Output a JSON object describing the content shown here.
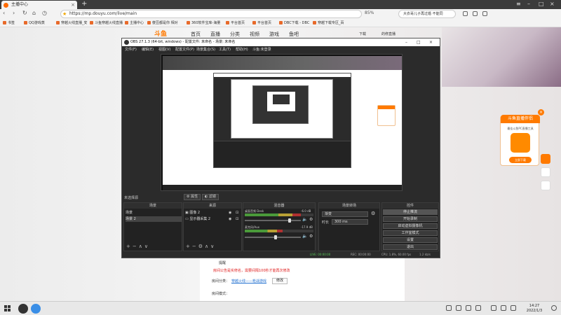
{
  "browser": {
    "tab_title": "主播中心",
    "url": "https://mp.douyu.com/live/main",
    "zoom": "85%",
    "news": "大衣哥儿子再过婚 不能同",
    "bookmarks": [
      "书签",
      "QQ游戏蒸",
      "穿越火线直播_安",
      "斗鱼穿越火线直播",
      "主播中心",
      "傻豆都是你 相对",
      "360软件宝库-海量",
      "平台首页",
      "平台首页",
      "DBC下载 - DBC",
      "穿越下载专区_百"
    ]
  },
  "site": {
    "logo": "斗鱼",
    "nav": [
      "首页",
      "直播",
      "分类",
      "视频",
      "游戏",
      "鱼吧"
    ],
    "user": "下载",
    "user2": "的修直播"
  },
  "page_content": {
    "label_notice": "提醒",
    "notice_red": "房间公告是实修名，需要间隔100秒才能再次修改",
    "label_room": "房间分类：",
    "room_link": "穿越火线——枪战游戏",
    "modify_btn": "修改",
    "label_status": "房间模式："
  },
  "ad": {
    "title": "斗鱼直播伴侣",
    "subtitle": "最佳斗鱼PC直播工具",
    "button": "立即下载",
    "close": "×"
  },
  "obs": {
    "title": "OBS 27.1.3 (64-bit, windows) - 配置文件: 未命名 - 场景: 未命名",
    "menus": [
      "文件(F)",
      "编辑(E)",
      "视图(V)",
      "配置文件(P)",
      "场景集合(S)",
      "工具(T)",
      "帮助(H)",
      "斗鱼:未登录"
    ],
    "no_source": "未选择源",
    "tab_props": "属性",
    "tab_filters": "滤镜",
    "docks": {
      "scenes": {
        "title": "场景",
        "items": [
          "场景",
          "场景 2"
        ]
      },
      "sources": {
        "title": "来源",
        "items": [
          "图像 2",
          "显示器采集 2"
        ]
      },
      "mixer": {
        "title": "混音器",
        "channels": [
          {
            "name": "桌面音频 Desk",
            "db": "-6.0 dB",
            "level": 0.82
          },
          {
            "name": "麦克风/Aux",
            "db": "-17.9 dB",
            "level": 0.55
          }
        ]
      },
      "transitions": {
        "title": "场景转场",
        "type": "渐变",
        "duration_label": "时长",
        "duration": "300 ms"
      },
      "controls": {
        "title": "控件",
        "buttons": [
          "停止推流",
          "开始录制",
          "启动虚拟摄像机",
          "工作室模式",
          "设置",
          "退出"
        ]
      }
    },
    "status": {
      "live": "LIVE: 00:00:00",
      "rec": "REC: 00:00:00",
      "cpu": "CPU: 1.8%, 60.00 fps",
      "kbps": "1.2 kb/s"
    }
  },
  "taskbar": {
    "time": "14:27",
    "date": "2022/1/3"
  }
}
